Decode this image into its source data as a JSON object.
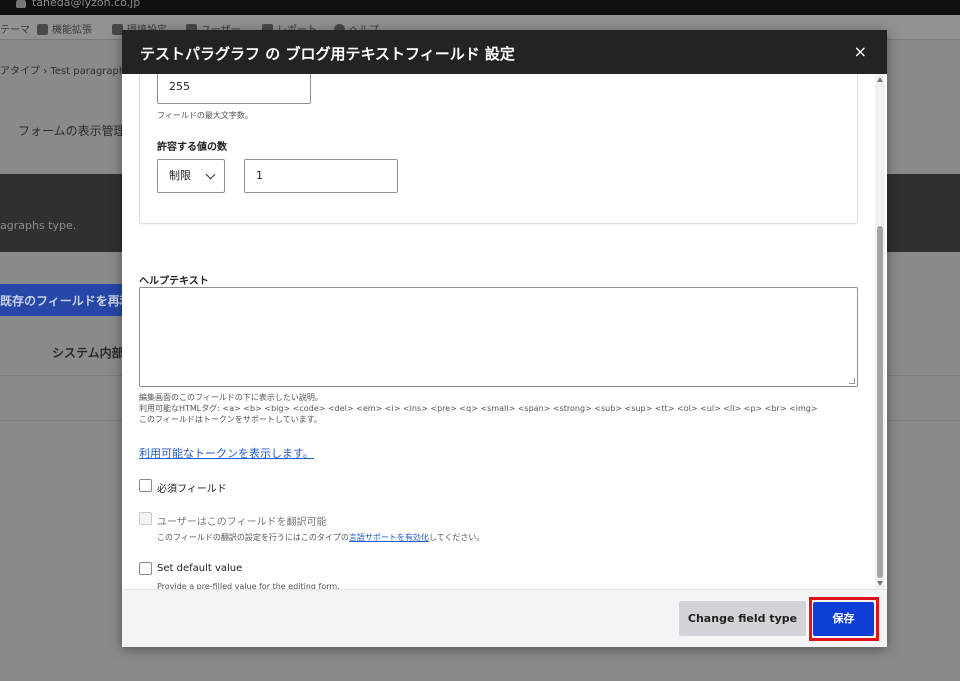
{
  "background": {
    "user_email": "taneda@lyzon.co.jp",
    "toolbar": [
      "テーマ",
      "機能拡張",
      "環境設定",
      "ユーザー",
      "レポート",
      "ヘルプ"
    ],
    "breadcrumb": "アタイプ  ›  Test paragraph",
    "tab_label": "フォームの表示管理",
    "band_text": "agraphs type.",
    "reuse_button": "既存のフィールドを再利用",
    "system_label": "システム内部名"
  },
  "modal": {
    "title": "テストパラグラフ の ブログ用テキストフィールド 設定",
    "close": "×",
    "max_length": {
      "value": "255",
      "description": "フィールドの最大文字数。"
    },
    "cardinality": {
      "label": "許容する値の数",
      "select_value": "制限",
      "number_value": "1"
    },
    "help_text": {
      "label": "ヘルプテキスト",
      "value": "",
      "description_line1": "編集画面のこのフィールドの下に表示したい説明。",
      "description_line2": "利用可能なHTMLタグ: <a> <b> <big> <code> <del> <em> <i> <ins> <pre> <q> <small> <span> <strong> <sub> <sup> <tt> <ol> <ul> <li> <p> <br> <img>",
      "description_line3": "このフィールドはトークンをサポートしています。"
    },
    "token_link": "利用可能なトークンを表示します。",
    "required_label": "必須フィールド",
    "translatable": {
      "label": "ユーザーはこのフィールドを翻訳可能",
      "desc_before": "このフィールドの翻訳の設定を行うにはこのタイプの",
      "desc_link": "言語サポートを有効化",
      "desc_after": "してください。"
    },
    "default_value": {
      "label": "Set default value",
      "description": "Provide a pre-filled value for the editing form."
    },
    "footer": {
      "change_type_button": "Change field type",
      "save_button": "保存"
    }
  },
  "colors": {
    "header_bg": "#232323",
    "primary_button": "#0d3fd6",
    "highlight_outline": "#e0121a",
    "link": "#1f5bd1"
  }
}
